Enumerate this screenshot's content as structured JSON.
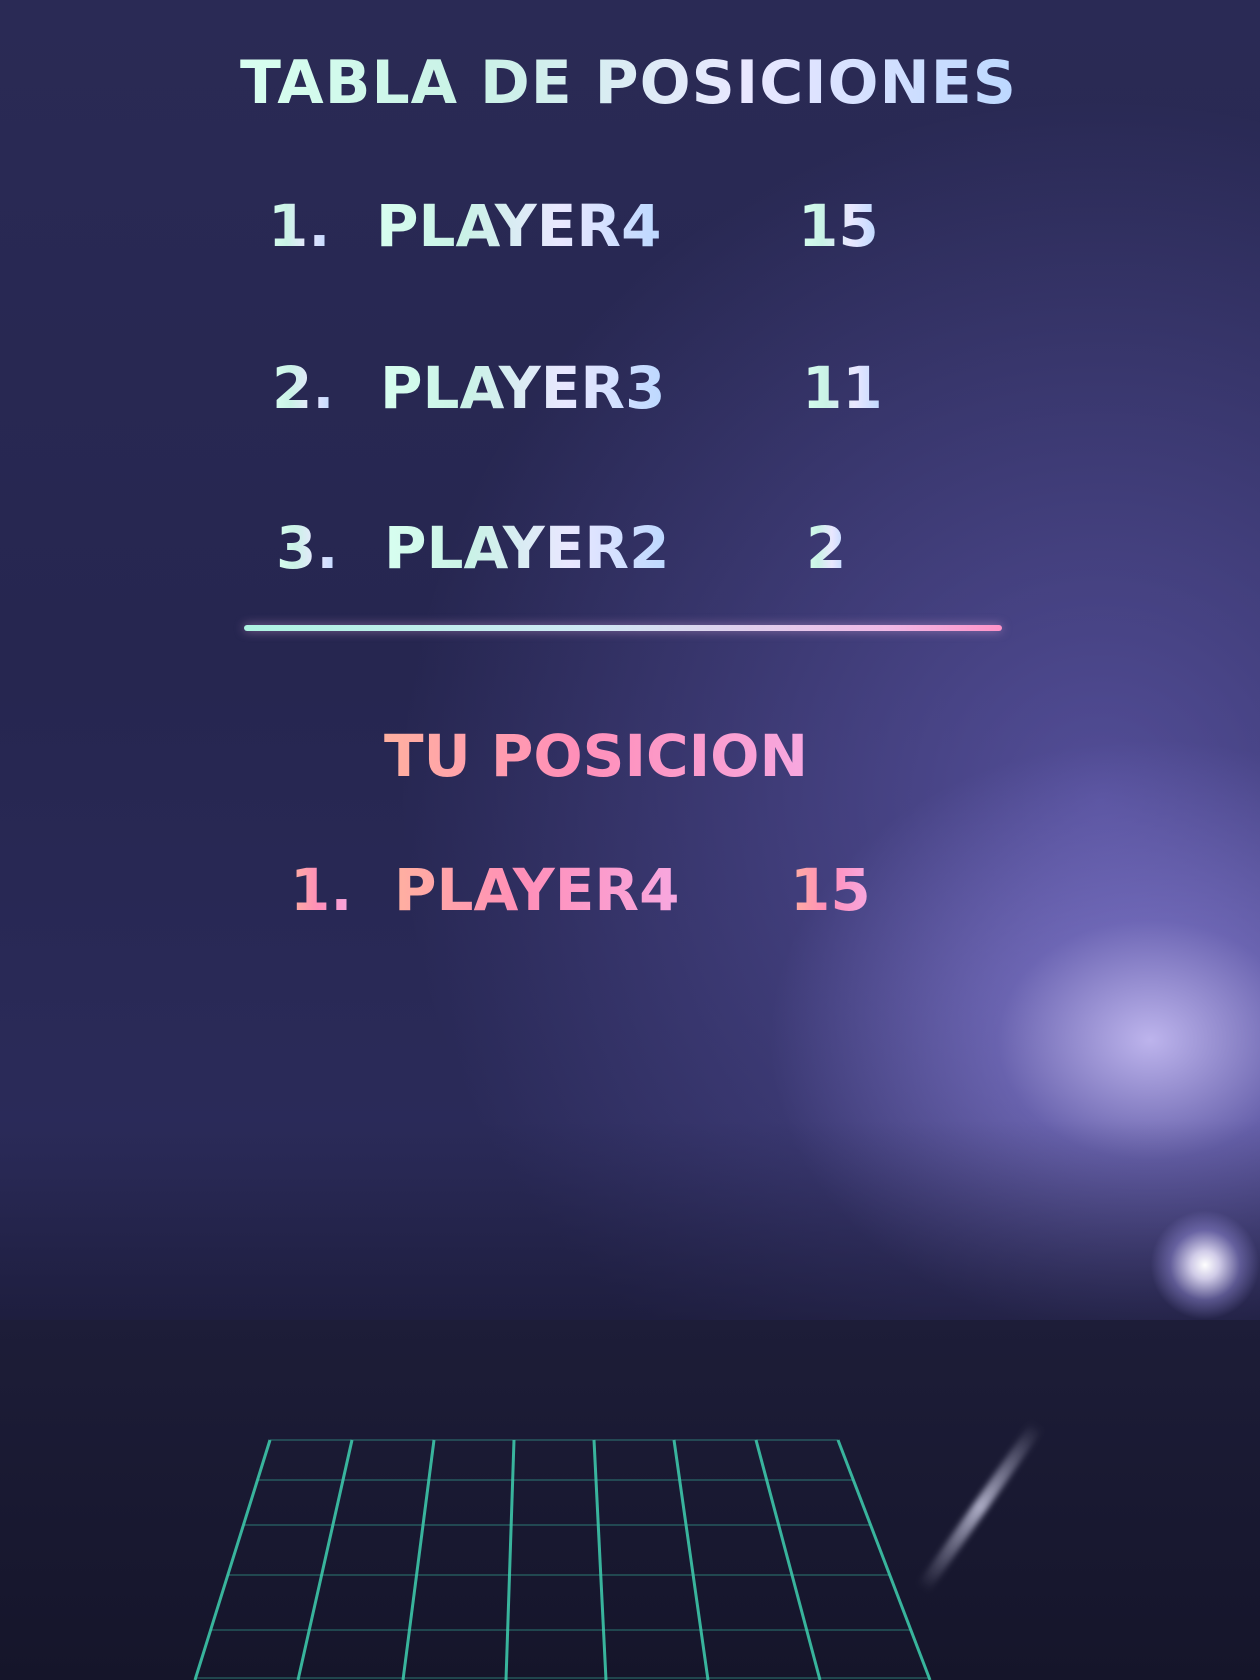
{
  "leaderboard": {
    "title": "TABLA DE POSICIONES",
    "entries": [
      {
        "rank": "1.",
        "name": "PLAYER4",
        "score": "15"
      },
      {
        "rank": "2.",
        "name": "PLAYER3",
        "score": "11"
      },
      {
        "rank": "3.",
        "name": "PLAYER2",
        "score": "2"
      }
    ]
  },
  "your_position": {
    "title": "TU POSICION",
    "rank": "1.",
    "name": "PLAYER4",
    "score": "15"
  },
  "colors": {
    "background": "#262650",
    "text_mint": "#c9f2e6",
    "text_pink": "#ff8fb8",
    "grid": "#3fd0b0"
  }
}
